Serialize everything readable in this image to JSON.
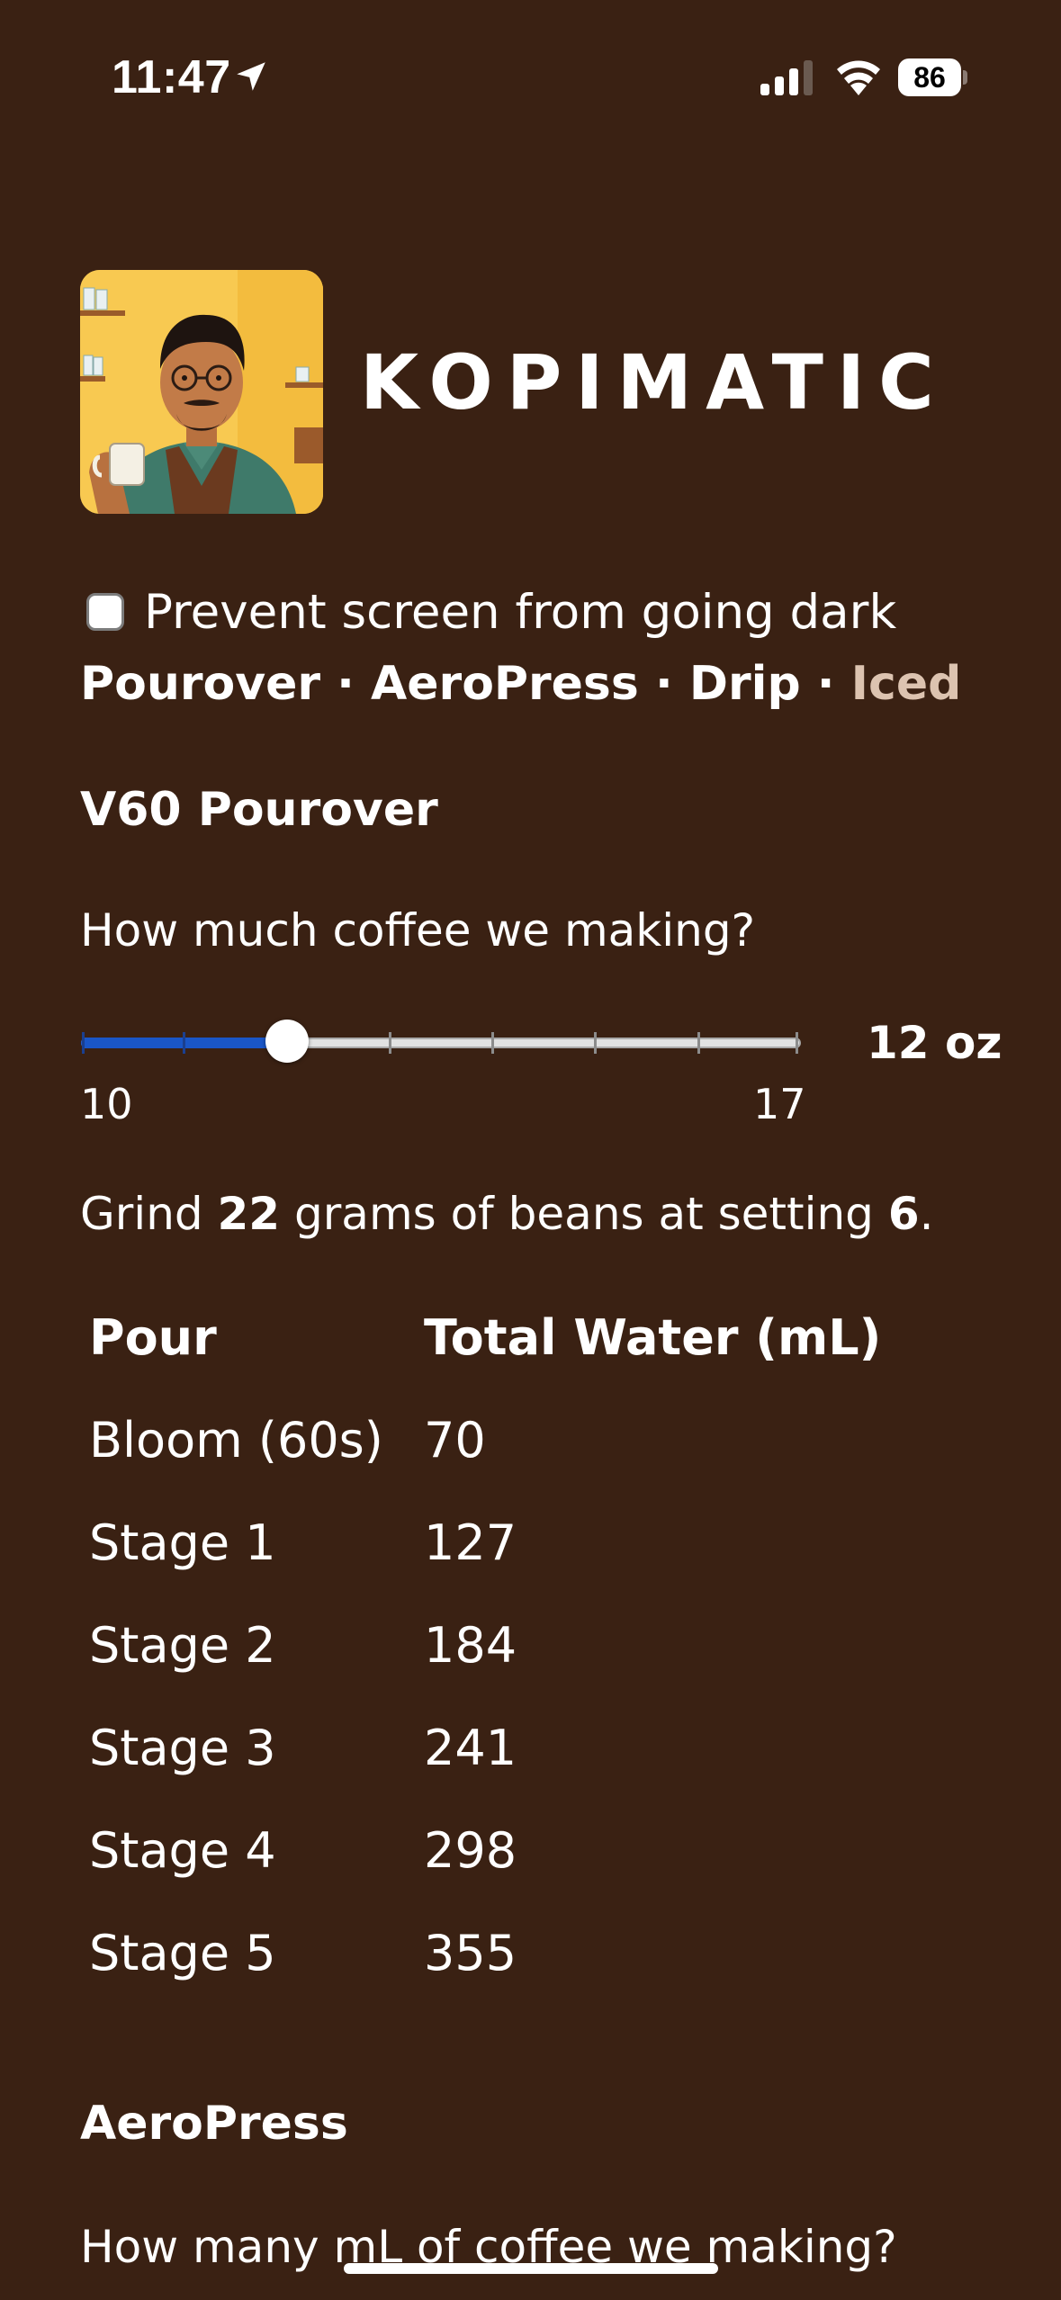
{
  "status_bar": {
    "time": "11:47",
    "battery": "86"
  },
  "brand": {
    "title": "KOPIMATIC",
    "logo_alt": "barista illustration"
  },
  "keep_awake": {
    "label": "Prevent screen from going dark",
    "checked": false
  },
  "nav": {
    "items": [
      {
        "label": "Pourover",
        "active": false
      },
      {
        "label": "AeroPress",
        "active": false
      },
      {
        "label": "Drip",
        "active": false
      },
      {
        "label": "Iced",
        "active": true
      }
    ],
    "separator": "·"
  },
  "v60": {
    "title": "V60 Pourover",
    "prompt": "How much coffee we making?",
    "slider": {
      "min": 10,
      "max": 17,
      "value": 12,
      "min_label": "10",
      "max_label": "17",
      "value_label": "12 oz"
    },
    "instruction": {
      "prefix": "Grind ",
      "grams": "22",
      "middle": " grams of beans at setting ",
      "setting": "6",
      "suffix": "."
    },
    "table": {
      "headers": [
        "Pour",
        "Total Water (mL)"
      ],
      "rows": [
        [
          "Bloom (60s)",
          "70"
        ],
        [
          "Stage 1",
          "127"
        ],
        [
          "Stage 2",
          "184"
        ],
        [
          "Stage 3",
          "241"
        ],
        [
          "Stage 4",
          "298"
        ],
        [
          "Stage 5",
          "355"
        ]
      ]
    }
  },
  "aeropress": {
    "title": "AeroPress",
    "prompt": "How many mL of coffee we making?"
  },
  "colors": {
    "background": "#3a2113",
    "slider_fill": "#1a56c7",
    "active_nav": "#dcc3b0"
  }
}
